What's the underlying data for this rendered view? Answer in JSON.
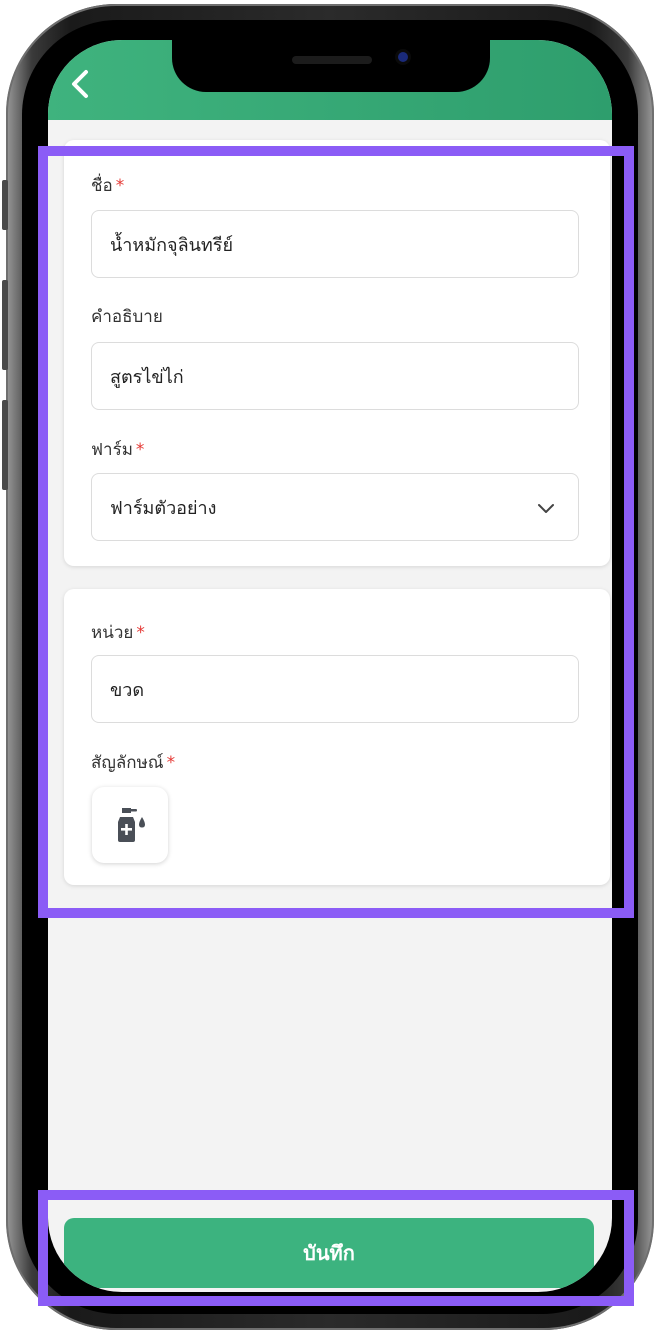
{
  "form": {
    "name": {
      "label": "ชื่อ",
      "required_mark": "*",
      "value": "น้ำหมักจุลินทรีย์"
    },
    "description": {
      "label": "คำอธิบาย",
      "value": "สูตรไข่ไก่"
    },
    "farm": {
      "label": "ฟาร์ม",
      "required_mark": "*",
      "value": "ฟาร์มตัวอย่าง"
    },
    "unit": {
      "label": "หน่วย",
      "required_mark": "*",
      "value": "ขวด"
    },
    "symbol": {
      "label": "สัญลักษณ์",
      "required_mark": "*",
      "icon": "spray-bottle-icon"
    }
  },
  "actions": {
    "save_label": "บันทึก"
  },
  "colors": {
    "header": "#2e9e6d",
    "button": "#3cb37f",
    "required": "#e53935",
    "highlight": "#8b5cf6"
  }
}
